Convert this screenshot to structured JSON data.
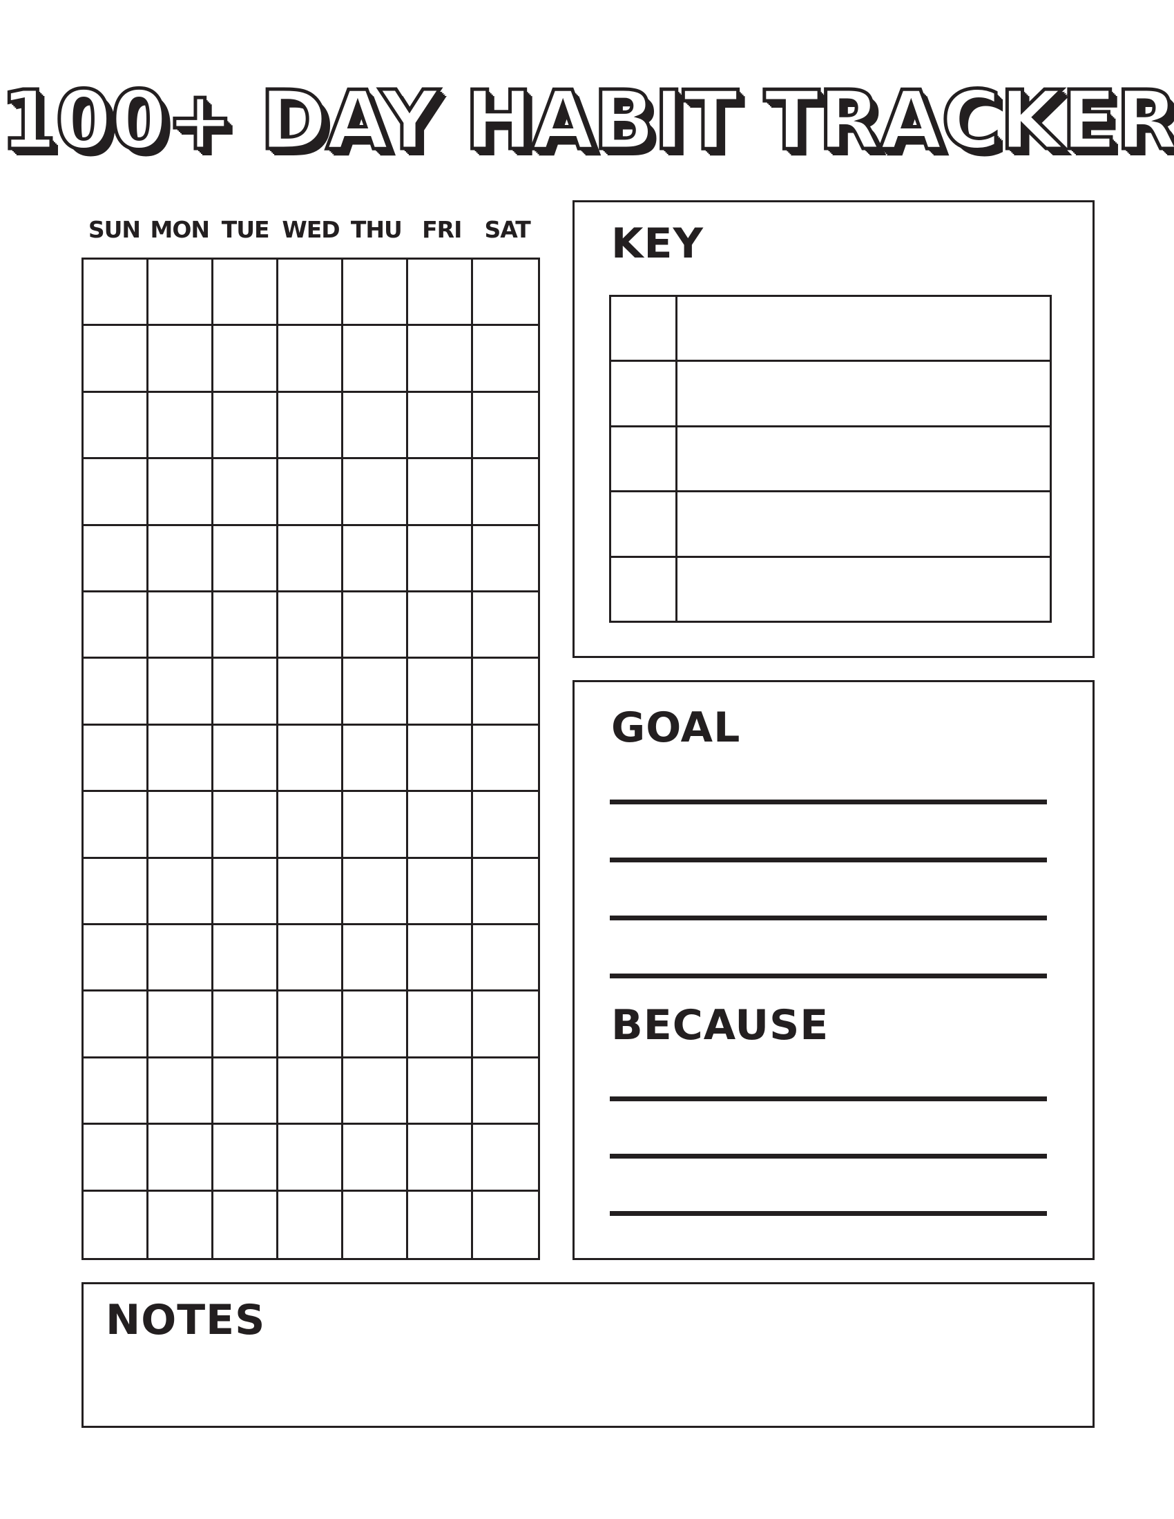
{
  "title": "100+ DAY HABIT TRACKER",
  "tracker": {
    "day_headers": [
      "SUN",
      "MON",
      "TUE",
      "WED",
      "THU",
      "FRI",
      "SAT"
    ],
    "rows": 15,
    "columns": 7
  },
  "key": {
    "heading": "KEY",
    "rows": 5
  },
  "goal": {
    "heading": "GOAL",
    "lines": 4
  },
  "because": {
    "heading": "BECAUSE",
    "lines": 3
  },
  "notes": {
    "heading": "NOTES"
  },
  "colors": {
    "ink": "#231f20",
    "paper": "#ffffff"
  }
}
